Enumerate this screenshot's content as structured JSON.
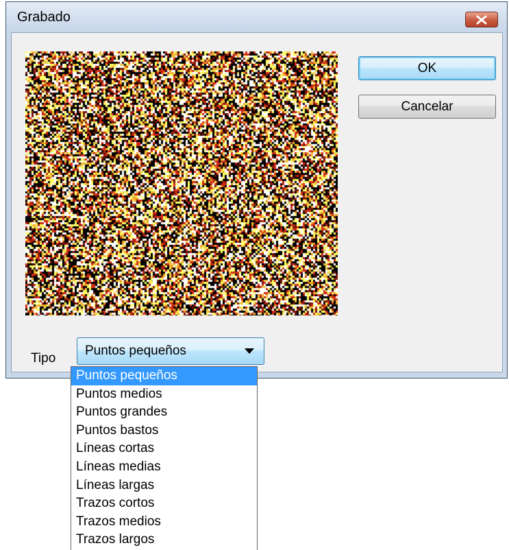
{
  "window": {
    "title": "Grabado"
  },
  "buttons": {
    "ok_label": "OK",
    "cancel_label": "Cancelar"
  },
  "type_field": {
    "label": "Tipo",
    "selected": "Puntos pequeños",
    "options": [
      "Puntos pequeños",
      "Puntos medios",
      "Puntos grandes",
      "Puntos bastos",
      "Líneas cortas",
      "Líneas medias",
      "Líneas largas",
      "Trazos cortos",
      "Trazos medios",
      "Trazos largos"
    ],
    "highlighted_index": 0
  },
  "preview": {
    "palette": [
      "#000000",
      "#ffffff",
      "#ffff66",
      "#e8c84a",
      "#d12a14",
      "#7a1408",
      "#f5a623"
    ]
  },
  "colors": {
    "selection": "#3399ff",
    "close_button": "#c75a3f",
    "titlebar": "#c6d5e8"
  },
  "icons": {
    "close": "close-x-icon",
    "dropdown": "dropdown-arrow-icon"
  }
}
